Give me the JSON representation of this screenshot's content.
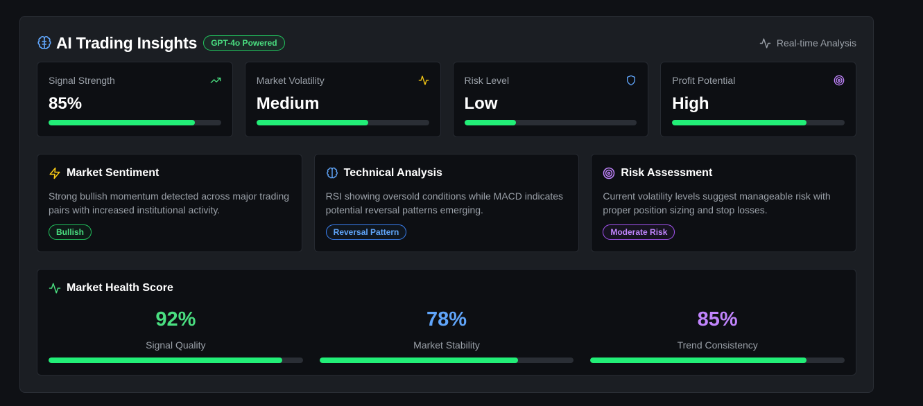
{
  "header": {
    "title": "AI Trading Insights",
    "badge": "GPT-4o Powered",
    "realtime_label": "Real-time Analysis"
  },
  "metrics": [
    {
      "label": "Signal Strength",
      "value": "85%",
      "icon": "trending-up-icon",
      "fill_pct": 85
    },
    {
      "label": "Market Volatility",
      "value": "Medium",
      "icon": "activity-icon",
      "fill_pct": 65
    },
    {
      "label": "Risk Level",
      "value": "Low",
      "icon": "shield-icon",
      "fill_pct": 30
    },
    {
      "label": "Profit Potential",
      "value": "High",
      "icon": "target-icon",
      "fill_pct": 78
    }
  ],
  "insights": [
    {
      "title": "Market Sentiment",
      "icon": "zap-icon",
      "description": "Strong bullish momentum detected across major trading pairs with increased institutional activity.",
      "tag": "Bullish",
      "tag_color": "#4ade80"
    },
    {
      "title": "Technical Analysis",
      "icon": "brain-icon",
      "description": "RSI showing oversold conditions while MACD indicates potential reversal patterns emerging.",
      "tag": "Reversal Pattern",
      "tag_color": "#60a5fa"
    },
    {
      "title": "Risk Assessment",
      "icon": "target-icon",
      "description": "Current volatility levels suggest manageable risk with proper position sizing and stop losses.",
      "tag": "Moderate Risk",
      "tag_color": "#c084fc"
    }
  ],
  "health": {
    "title": "Market Health Score",
    "scores": [
      {
        "value": "92%",
        "label": "Signal Quality",
        "color": "#4ade80",
        "fill_pct": 92
      },
      {
        "value": "78%",
        "label": "Market Stability",
        "color": "#60a5fa",
        "fill_pct": 78
      },
      {
        "value": "85%",
        "label": "Trend Consistency",
        "color": "#c084fc",
        "fill_pct": 85
      }
    ]
  },
  "colors": {
    "accent_green": "#22ee77",
    "bar_track": "#2a2e35",
    "panel_bg": "#1b1e23",
    "card_bg": "#0d0f13"
  }
}
